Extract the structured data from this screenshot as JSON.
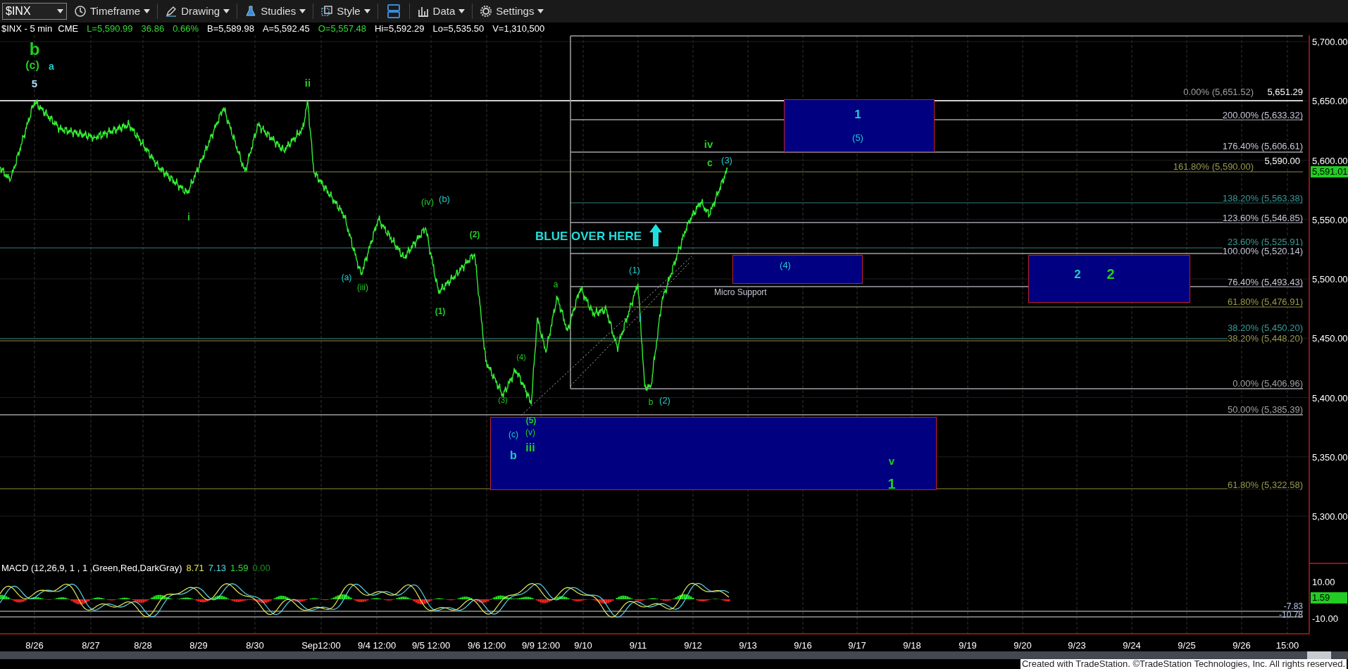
{
  "toolbar": {
    "symbol": "$INX",
    "items": [
      {
        "label": "Timeframe",
        "kind": "clock"
      },
      {
        "label": "Drawing",
        "kind": "pen"
      },
      {
        "label": "Studies",
        "kind": "flask"
      },
      {
        "label": "Style",
        "kind": "style"
      },
      {
        "label": "Data",
        "kind": "bars"
      },
      {
        "label": "Settings",
        "kind": "gear"
      }
    ]
  },
  "quote": [
    {
      "text": "$INX - 5 min",
      "color": "#ffffff"
    },
    {
      "text": "CME",
      "color": "#ffffff"
    },
    {
      "text": "L=5,590.99",
      "color": "#33dd33"
    },
    {
      "text": "36.86",
      "color": "#33dd33"
    },
    {
      "text": "0.66%",
      "color": "#33dd33"
    },
    {
      "text": "B=5,589.98",
      "color": "#ffffff"
    },
    {
      "text": "A=5,592.45",
      "color": "#ffffff"
    },
    {
      "text": "O=5,557.48",
      "color": "#33dd33"
    },
    {
      "text": "Hi=5,592.29",
      "color": "#ffffff"
    },
    {
      "text": "Lo=5,535.50",
      "color": "#ffffff"
    },
    {
      "text": "V=1,310,500",
      "color": "#ffffff"
    }
  ],
  "chart": {
    "wave_labels": [
      {
        "text": "b",
        "color": "#22cc22"
      },
      {
        "text": "(c)",
        "color": "#22cc22"
      },
      {
        "text": "a",
        "color": "#22cccc"
      },
      {
        "text": "5",
        "color": "#aaddff"
      },
      {
        "text": "ii",
        "color": "#22cc22"
      },
      {
        "text": "i",
        "color": "#22cc22"
      },
      {
        "text": "(iv)",
        "color": "#22cc22"
      },
      {
        "text": "(b)",
        "color": "#22cccc"
      },
      {
        "text": "(a)",
        "color": "#22cccc"
      },
      {
        "text": "(iii)",
        "color": "#22cc22"
      },
      {
        "text": "(1)",
        "color": "#22cc22"
      },
      {
        "text": "(2)",
        "color": "#22cc22"
      },
      {
        "text": "(3)",
        "color": "#22cc22"
      },
      {
        "text": "(4)",
        "color": "#22cc22"
      },
      {
        "text": "(5)",
        "color": "#22cc22"
      },
      {
        "text": "(c)",
        "color": "#22cccc"
      },
      {
        "text": "(v)",
        "color": "#22cc22"
      },
      {
        "text": "b",
        "color": "#22cccc"
      },
      {
        "text": "iii",
        "color": "#22cc22"
      },
      {
        "text": "a",
        "color": "#22cc22"
      },
      {
        "text": "(1)",
        "color": "#22cccc"
      },
      {
        "text": "i",
        "color": "#22cccc"
      },
      {
        "text": "b",
        "color": "#22cc22"
      },
      {
        "text": "(2)",
        "color": "#22cccc"
      },
      {
        "text": "iv",
        "color": "#22cc22"
      },
      {
        "text": "c",
        "color": "#22cc22"
      },
      {
        "text": "(3)",
        "color": "#22cccc"
      },
      {
        "text": "v",
        "color": "#22cc22"
      },
      {
        "text": "1",
        "color": "#22cc22"
      }
    ],
    "callout": "BLUE OVER HERE",
    "support_label": "Micro Support",
    "zones": [
      {
        "labels": [
          {
            "text": "1",
            "color": "#22cccc"
          },
          {
            "text": "(5)",
            "color": "#22cccc"
          }
        ]
      },
      {
        "labels": [
          {
            "text": "(4)",
            "color": "#22cccc"
          }
        ]
      },
      {
        "labels": [
          {
            "text": "2",
            "color": "#22cccc"
          },
          {
            "text": "2",
            "color": "#22cc22"
          }
        ]
      }
    ],
    "fib_levels": [
      {
        "text": "0.00% (5,651.52)",
        "color": "#a0a0a0"
      },
      {
        "text": "5,651.29",
        "color": "#ffffff"
      },
      {
        "text": "200.00% (5,633.32)",
        "color": "#c8c8d8"
      },
      {
        "text": "176.40% (5,606.61)",
        "color": "#c8c8d8"
      },
      {
        "text": "5,590.00",
        "color": "#ffffff"
      },
      {
        "text": "161.80% (5,590.00)",
        "color": "#9a9a50"
      },
      {
        "text": "138.20% (5,563.38)",
        "color": "#3a9a9a"
      },
      {
        "text": "123.60% (5,546.85)",
        "color": "#c8c8d8"
      },
      {
        "text": "23.60% (5,525.91)",
        "color": "#3a9a9a"
      },
      {
        "text": "100.00% (5,520.14)",
        "color": "#c8c8d8"
      },
      {
        "text": "76.40% (5,493.43)",
        "color": "#c8c8d8"
      },
      {
        "text": "61.80% (5,476.91)",
        "color": "#9a9a50"
      },
      {
        "text": "38.20% (5,450.20)",
        "color": "#3a9a9a"
      },
      {
        "text": "38.20% (5,448.20)",
        "color": "#9a9a50"
      },
      {
        "text": "0.00% (5,406.96)",
        "color": "#a0a0a0"
      },
      {
        "text": "50.00% (5,385.39)",
        "color": "#a0a0a0"
      },
      {
        "text": "61.80% (5,322.58)",
        "color": "#9a9a50"
      }
    ],
    "price_axis": [
      "5,700.00",
      "5,650.00",
      "5,600.00",
      "5,550.00",
      "5,500.00",
      "5,450.00",
      "5,400.00",
      "5,350.00",
      "5,300.00"
    ],
    "last_price": "5,591.01",
    "time_axis": [
      "8/26",
      "8/27",
      "8/28",
      "8/29",
      "8/30",
      "Sep12:00",
      "9/4 12:00",
      "9/5 12:00",
      "9/6 12:00",
      "9/9 12:00",
      "9/10",
      "9/11",
      "9/12",
      "9/13",
      "9/16",
      "9/17",
      "9/18",
      "9/19",
      "9/20",
      "9/23",
      "9/24",
      "9/25",
      "9/26",
      "15:00"
    ]
  },
  "macd": {
    "title": "MACD (12,26,9, 1 , 1 ,Green,Red,DarkGray)",
    "values": [
      {
        "text": "8.71",
        "color": "#e8e85a"
      },
      {
        "text": "7.13",
        "color": "#5ad8e8"
      },
      {
        "text": "1.59",
        "color": "#33dd33"
      },
      {
        "text": "0.00",
        "color": "#1f8f1f"
      }
    ],
    "axis": [
      "10.00",
      "-10.00"
    ],
    "last_value": "1.59",
    "level_labels": [
      "-7.83",
      "-10.78"
    ]
  },
  "footer": "Created with TradeStation. ©TradeStation Technologies, Inc. All rights reserved."
}
